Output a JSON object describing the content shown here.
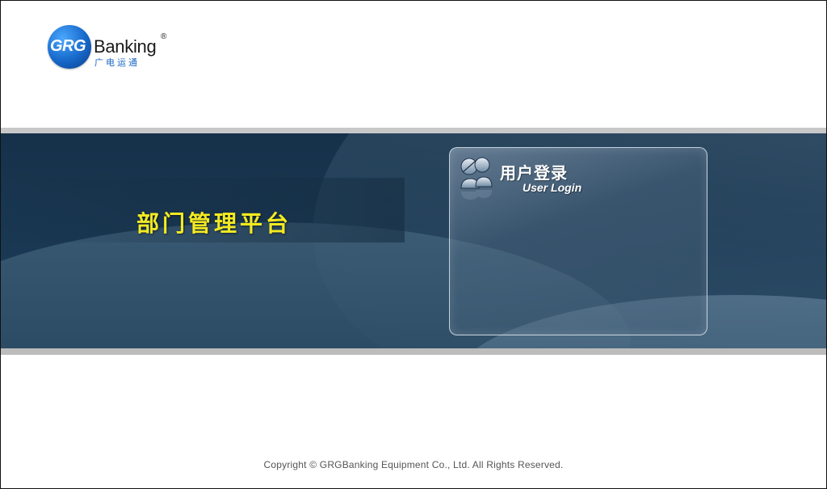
{
  "logo": {
    "mark": "GRG",
    "name": "Banking",
    "registered": "®",
    "chinese": "广电运通"
  },
  "banner": {
    "title": "部门管理平台"
  },
  "login": {
    "title": "用户登录",
    "subtitle": "User Login",
    "icon": "users-icon"
  },
  "footer": {
    "copyright": "Copyright ©  GRGBanking Equipment Co., Ltd.  All Rights Reserved."
  },
  "colors": {
    "title_yellow": "#f4ea21",
    "banner_dark": "#16314a",
    "logo_blue": "#1668c9"
  }
}
